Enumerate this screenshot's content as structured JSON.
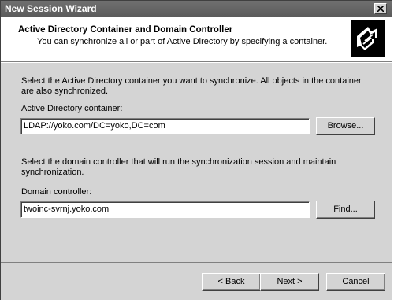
{
  "window": {
    "title": "New Session Wizard"
  },
  "header": {
    "title": "Active Directory Container and Domain Controller",
    "subtitle": "You can synchronize all or part of Active Directory by specifying a container."
  },
  "container_section": {
    "description": "Select the Active Directory container you want to synchronize. All objects in the container are also synchronized.",
    "label": "Active Directory container:",
    "value": "LDAP://yoko.com/DC=yoko,DC=com",
    "browse_label": "Browse..."
  },
  "dc_section": {
    "description": "Select the domain controller that will run the synchronization session and maintain synchronization.",
    "label": "Domain controller:",
    "value": "twoinc-svrnj.yoko.com",
    "find_label": "Find..."
  },
  "footer": {
    "back_label": "< Back",
    "next_label": "Next >",
    "cancel_label": "Cancel"
  },
  "icons": {
    "close": "close-icon",
    "wizard": "wizard-icon"
  }
}
